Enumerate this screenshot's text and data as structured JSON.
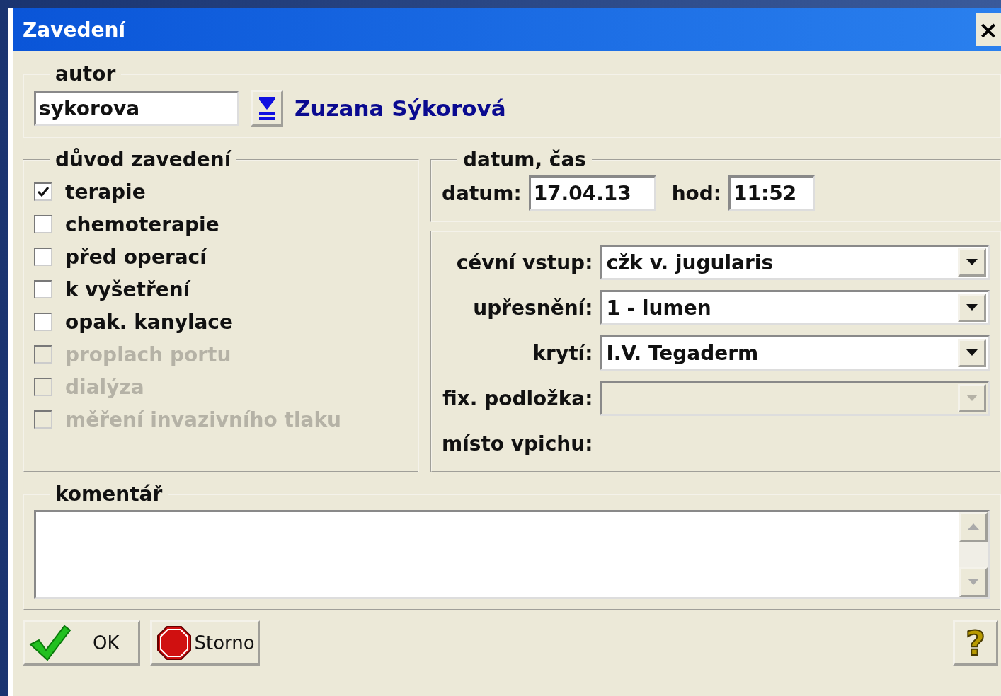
{
  "window": {
    "title": "Zavedení",
    "close": "×"
  },
  "author": {
    "legend": "autor",
    "value": "sykorova",
    "name": "Zuzana Sýkorová"
  },
  "reason": {
    "legend": "důvod zavedení",
    "items": [
      {
        "label": "terapie",
        "checked": true,
        "disabled": false
      },
      {
        "label": "chemoterapie",
        "checked": false,
        "disabled": false
      },
      {
        "label": "před operací",
        "checked": false,
        "disabled": false
      },
      {
        "label": "k vyšetření",
        "checked": false,
        "disabled": false
      },
      {
        "label": "opak. kanylace",
        "checked": false,
        "disabled": false
      },
      {
        "label": "proplach portu",
        "checked": false,
        "disabled": true
      },
      {
        "label": "dialýza",
        "checked": false,
        "disabled": true
      },
      {
        "label": "měření invazivního tlaku",
        "checked": false,
        "disabled": true
      }
    ]
  },
  "datetime": {
    "legend": "datum, čas",
    "date_label": "datum:",
    "date": "17.04.13",
    "time_label": "hod:",
    "time": "11:52"
  },
  "fields": [
    {
      "kind": "combo",
      "label": "cévní vstup:",
      "value": "cžk v. jugularis",
      "disabled": false
    },
    {
      "kind": "combo",
      "label": "upřesnění:",
      "value": "1 - lumen",
      "disabled": false
    },
    {
      "kind": "combo",
      "label": "krytí:",
      "value": "I.V. Tegaderm",
      "disabled": false
    },
    {
      "kind": "combo",
      "label": "fix. podložka:",
      "disabled": true
    },
    {
      "kind": "label",
      "label": "místo vpichu:"
    }
  ],
  "comment": {
    "legend": "komentář"
  },
  "buttons": [
    {
      "kind": "ok",
      "label": "OK"
    },
    {
      "kind": "cancel",
      "label": "Storno"
    }
  ],
  "help": "?"
}
